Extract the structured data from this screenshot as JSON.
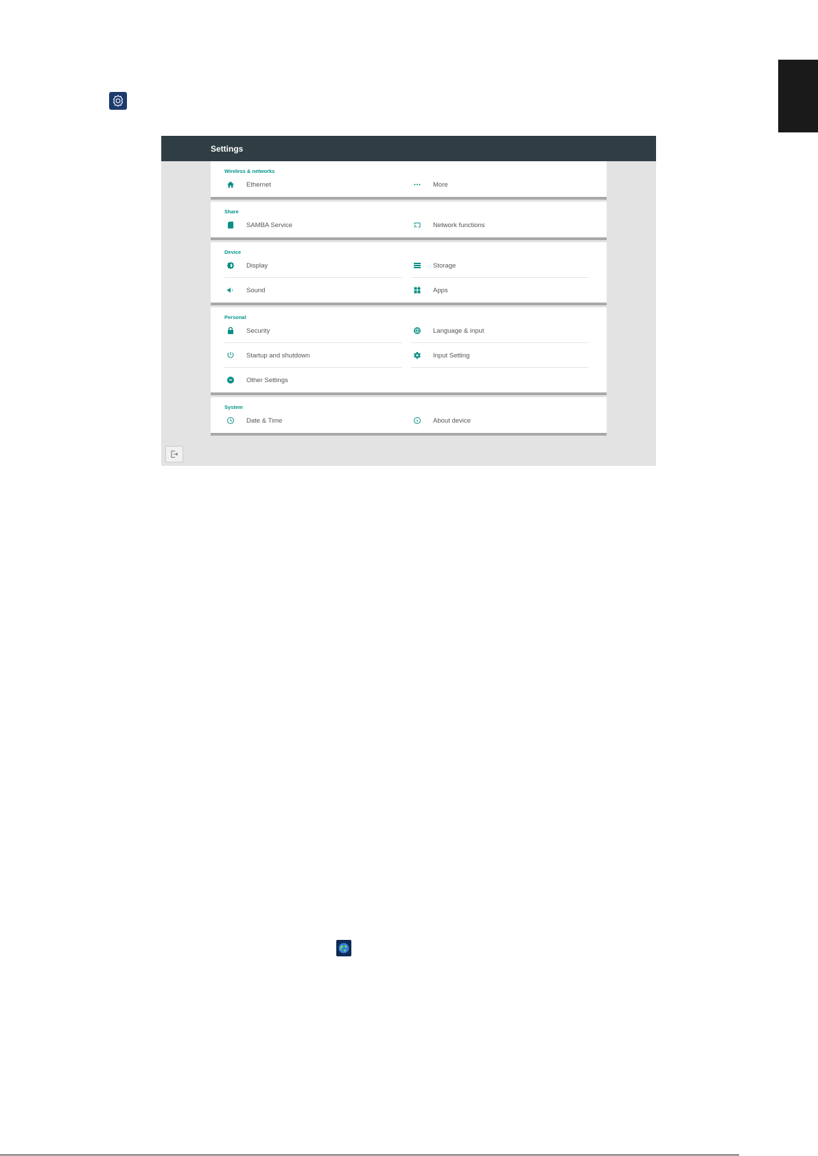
{
  "colors": {
    "appbar": "#2f3e44",
    "accent": "#009688",
    "icon": "#0a8f84",
    "background": "#e3e3e3"
  },
  "settings": {
    "title": "Settings",
    "sections": [
      {
        "header": "Wireless & networks",
        "items": [
          {
            "label": "Ethernet",
            "icon": "home-icon"
          },
          {
            "label": "More",
            "icon": "more-dots-icon"
          }
        ]
      },
      {
        "header": "Share",
        "items": [
          {
            "label": "SAMBA Service",
            "icon": "sd-card-icon"
          },
          {
            "label": "Network functions",
            "icon": "cast-icon"
          }
        ]
      },
      {
        "header": "Device",
        "items": [
          {
            "label": "Display",
            "icon": "brightness-icon"
          },
          {
            "label": "Storage",
            "icon": "storage-icon"
          },
          {
            "label": "Sound",
            "icon": "volume-icon"
          },
          {
            "label": "Apps",
            "icon": "apps-icon"
          }
        ]
      },
      {
        "header": "Personal",
        "items": [
          {
            "label": "Security",
            "icon": "lock-icon"
          },
          {
            "label": "Language & input",
            "icon": "globe-icon"
          },
          {
            "label": "Startup and shutdown",
            "icon": "power-icon"
          },
          {
            "label": "Input Setting",
            "icon": "gear-icon"
          },
          {
            "label": "Other Settings",
            "icon": "chevron-circle-icon"
          }
        ]
      },
      {
        "header": "System",
        "items": [
          {
            "label": "Date & Time",
            "icon": "clock-icon"
          },
          {
            "label": "About device",
            "icon": "info-icon"
          }
        ]
      }
    ]
  }
}
